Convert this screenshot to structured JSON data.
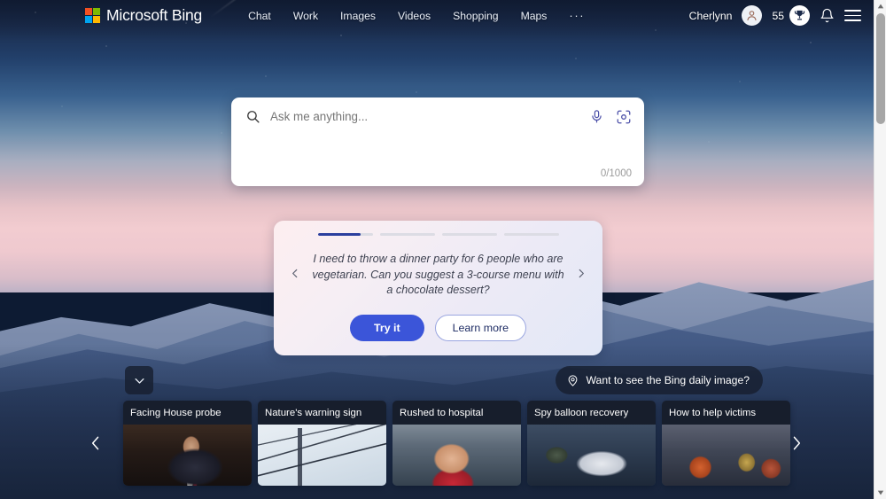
{
  "header": {
    "brand": "Microsoft Bing",
    "logo_icon": "microsoft-logo-icon",
    "logo_colors": [
      "#f25022",
      "#7fba00",
      "#00a4ef",
      "#ffb900"
    ],
    "nav": [
      {
        "label": "Chat"
      },
      {
        "label": "Work"
      },
      {
        "label": "Images"
      },
      {
        "label": "Videos"
      },
      {
        "label": "Shopping"
      },
      {
        "label": "Maps"
      }
    ],
    "more_label": "···",
    "user": {
      "name": "Cherlynn",
      "avatar_icon": "person-avatar-icon"
    },
    "rewards": {
      "count": "55",
      "icon": "trophy-icon"
    },
    "notifications_icon": "bell-icon",
    "menu_icon": "hamburger-menu-icon"
  },
  "search": {
    "placeholder": "Ask me anything...",
    "value": "",
    "search_icon": "search-icon",
    "mic_icon": "microphone-icon",
    "visual_search_icon": "visual-search-camera-icon",
    "char_count": "0/1000"
  },
  "suggestion": {
    "text": "I need to throw a dinner party for 6 people who are vegetarian. Can you suggest a 3-course menu with a chocolate dessert?",
    "prev_icon": "chevron-left-icon",
    "next_icon": "chevron-right-icon",
    "primary_button": "Try it",
    "secondary_button": "Learn more",
    "progress": [
      {
        "fill": 78
      },
      {
        "fill": 0
      },
      {
        "fill": 0
      },
      {
        "fill": 0
      }
    ],
    "accent_color": "#2b3f9e",
    "button_color": "#3b55d9"
  },
  "daily_image": {
    "label": "Want to see the Bing daily image?",
    "icon": "location-pin-icon"
  },
  "collapse": {
    "icon": "chevron-down-icon"
  },
  "cards": [
    {
      "title": "Facing House probe",
      "img_class": "img-a"
    },
    {
      "title": "Nature's warning sign",
      "img_class": "img-b"
    },
    {
      "title": "Rushed to hospital",
      "img_class": "img-c"
    },
    {
      "title": "Spy balloon recovery",
      "img_class": "img-d"
    },
    {
      "title": "How to help victims",
      "img_class": "img-e"
    }
  ],
  "carousel": {
    "prev_icon": "chevron-left-icon",
    "next_icon": "chevron-right-icon",
    "prev_label": "‹",
    "next_label": "›"
  },
  "scrollbar": {
    "up_icon": "scroll-up-arrow-icon",
    "down_icon": "scroll-down-arrow-icon"
  }
}
